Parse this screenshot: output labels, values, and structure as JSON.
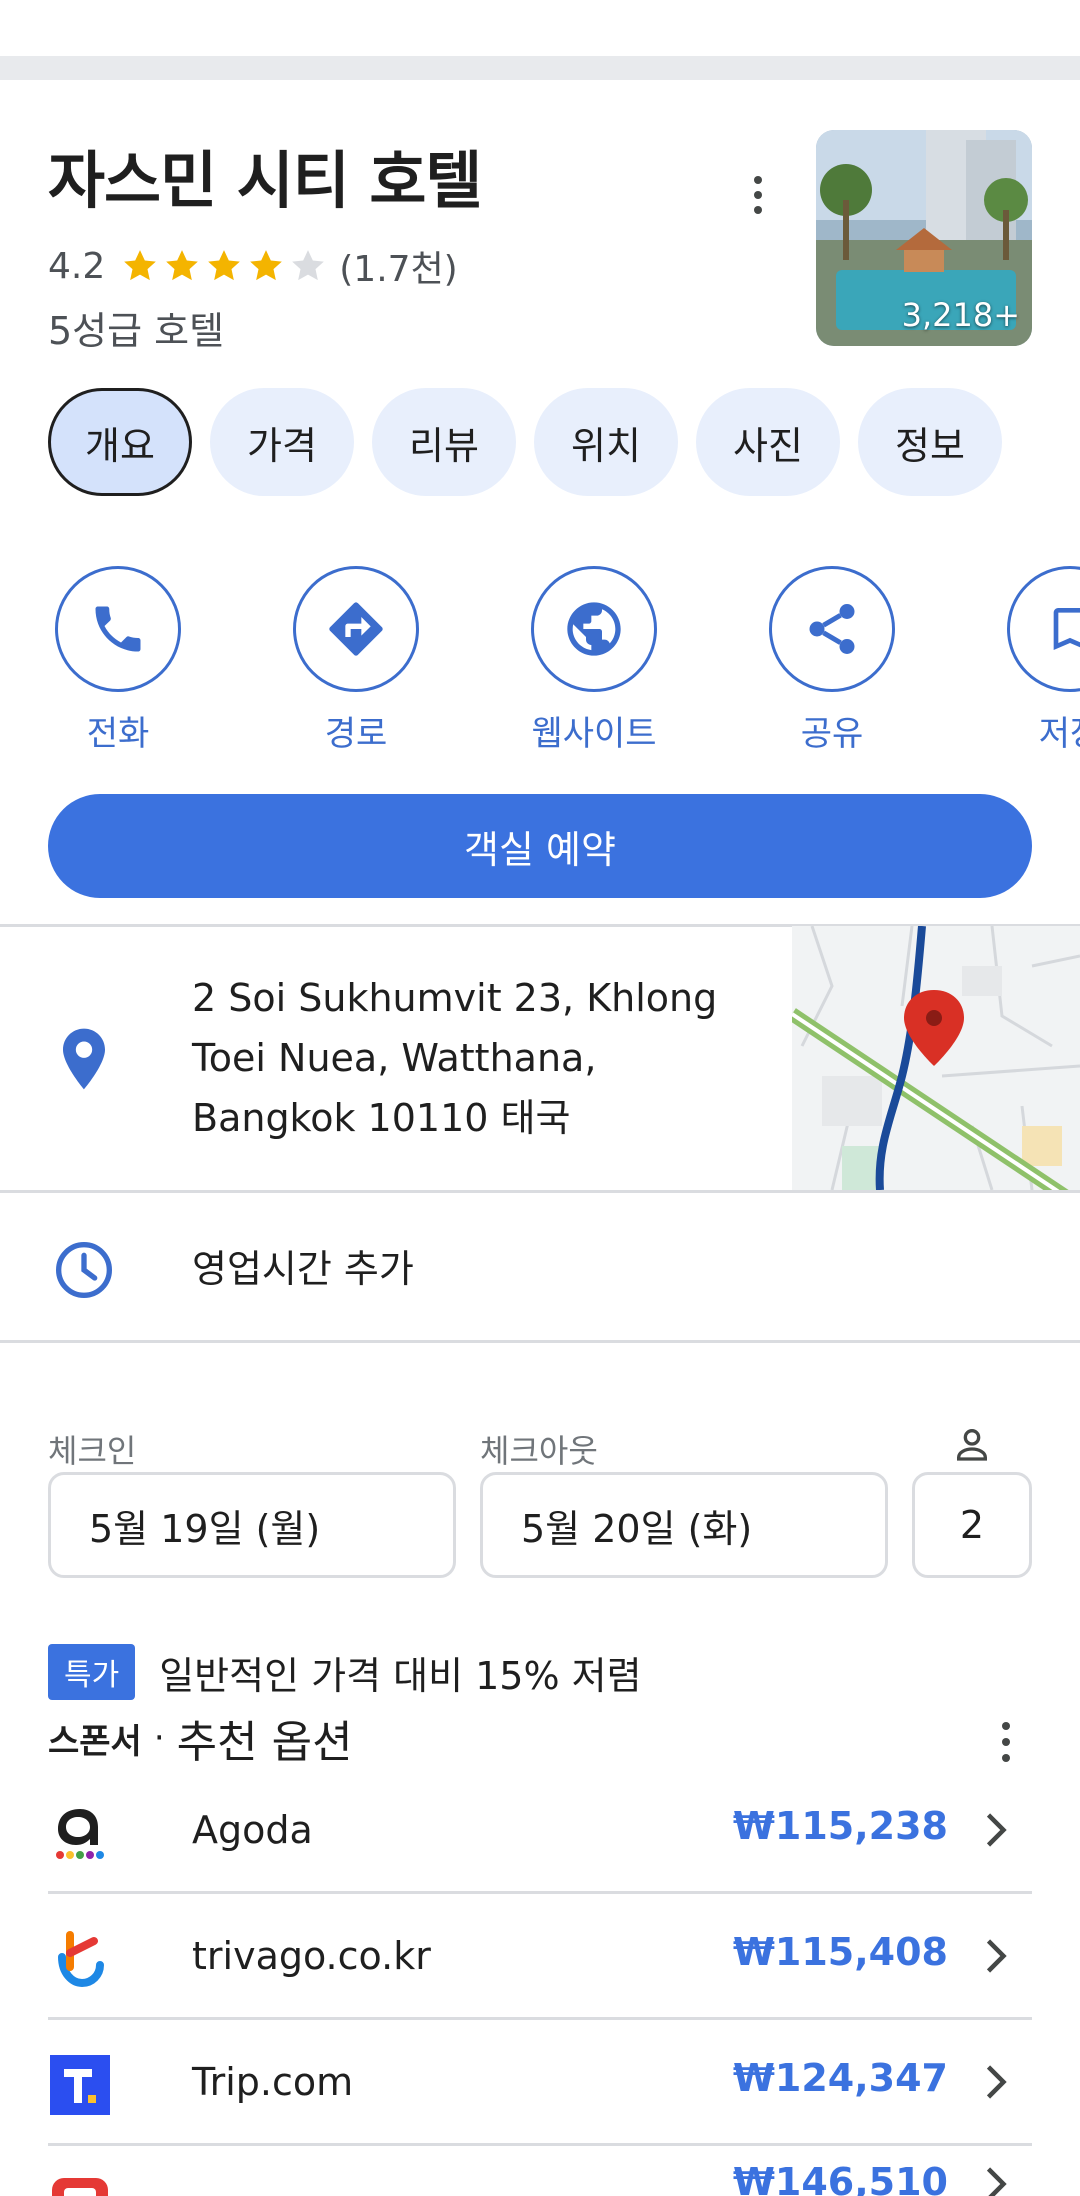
{
  "hotel": {
    "name": "자스민 시티 호텔",
    "rating": "4.2",
    "stars_filled": 4,
    "stars_total": 5,
    "review_count": "(1.7천)",
    "category": "5성급 호텔",
    "photo_count": "3,218+"
  },
  "tabs": [
    "개요",
    "가격",
    "리뷰",
    "위치",
    "사진",
    "정보"
  ],
  "active_tab": "개요",
  "actions": [
    {
      "label": "전화",
      "icon": "phone-icon"
    },
    {
      "label": "경로",
      "icon": "directions-icon"
    },
    {
      "label": "웹사이트",
      "icon": "globe-icon"
    },
    {
      "label": "공유",
      "icon": "share-icon"
    },
    {
      "label": "저장",
      "icon": "bookmark-icon"
    }
  ],
  "book_button": "객실 예약",
  "address": "2 Soi Sukhumvit 23, Khlong Toei Nuea, Watthana, Bangkok 10110 태국",
  "hours": "영업시간 추가",
  "booking": {
    "checkin_label": "체크인",
    "checkin_value": "5월 19일 (월)",
    "checkout_label": "체크아웃",
    "checkout_value": "5월 20일 (화)",
    "guests": "2"
  },
  "deal": {
    "badge": "특가",
    "text": "일반적인 가격 대비 15% 저렴"
  },
  "sponsor": {
    "strong": "스폰서",
    "dot": "·",
    "title": "추천 옵션"
  },
  "offers": [
    {
      "name": "Agoda",
      "price": "₩115,238"
    },
    {
      "name": "trivago.co.kr",
      "price": "₩115,408"
    },
    {
      "name": "Trip.com",
      "price": "₩124,347"
    },
    {
      "name": "",
      "price": "₩146,510"
    }
  ],
  "colors": {
    "accent": "#3b72df",
    "accent_outline": "#3c6dcd",
    "chip_bg": "#e8effc",
    "star": "#f4b400",
    "map_pin": "#d93025"
  }
}
